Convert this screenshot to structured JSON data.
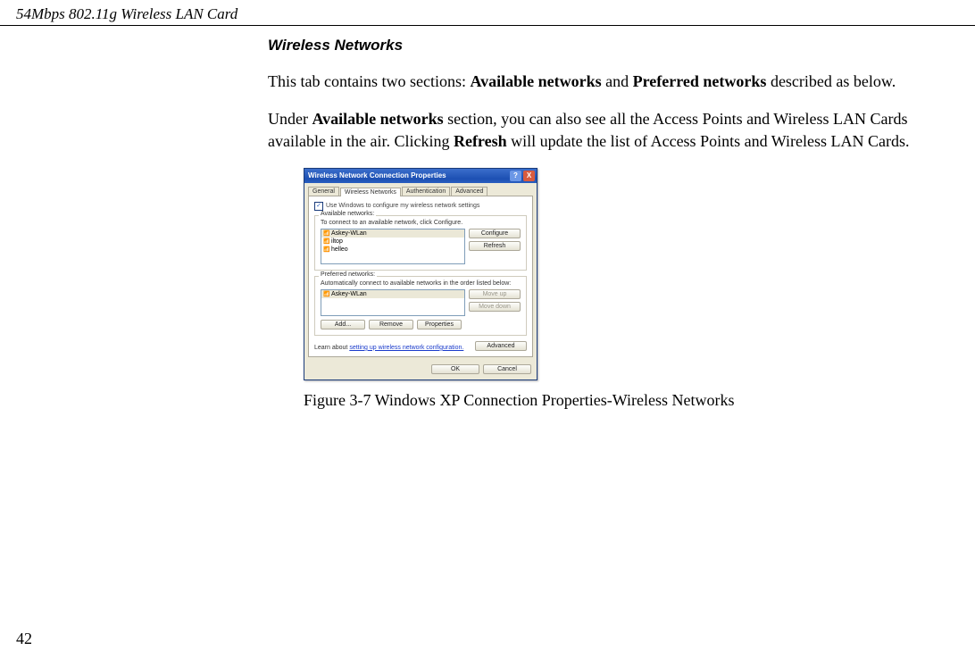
{
  "page": {
    "running_header": "54Mbps 802.11g Wireless LAN Card",
    "number": "42"
  },
  "section": {
    "title": "Wireless Networks"
  },
  "body": {
    "p1_before": "This tab contains two sections: ",
    "p1_strong1": "Available networks",
    "p1_mid": " and ",
    "p1_strong2": "Preferred networks",
    "p1_after": " described as below.",
    "p2_before": "Under ",
    "p2_strong1": "Available networks",
    "p2_mid1": " section, you can also see all the Access Points and Wireless LAN Cards available in the air. Clicking ",
    "p2_strong2": "Refresh",
    "p2_after": " will update the list of Access Points and Wireless LAN Cards."
  },
  "figure": {
    "caption": "Figure 3-7   Windows  XP Connection Properties-Wireless Networks"
  },
  "dialog": {
    "title": "Wireless Network Connection Properties",
    "help": "?",
    "close": "X",
    "tabs": {
      "general": "General",
      "wireless": "Wireless Networks",
      "auth": "Authentication",
      "advanced": "Advanced"
    },
    "use_windows": "Use Windows to configure my wireless network settings",
    "checkmark": "✓",
    "available_group": "Available networks:",
    "available_hint": "To connect to an available network, click Configure.",
    "available_items": {
      "0": "Askey-WLan",
      "1": "iltop",
      "2": "helleo"
    },
    "btn_configure": "Configure",
    "btn_refresh": "Refresh",
    "preferred_group": "Preferred networks:",
    "preferred_hint": "Automatically connect to available networks in the order listed below:",
    "preferred_items": {
      "0": "Askey-WLan"
    },
    "btn_moveup": "Move up",
    "btn_movedown": "Move down",
    "btn_add": "Add...",
    "btn_remove": "Remove",
    "btn_properties": "Properties",
    "learn_prefix": "Learn about ",
    "learn_link": "setting up wireless network configuration.",
    "btn_advanced": "Advanced",
    "btn_ok": "OK",
    "btn_cancel": "Cancel"
  }
}
